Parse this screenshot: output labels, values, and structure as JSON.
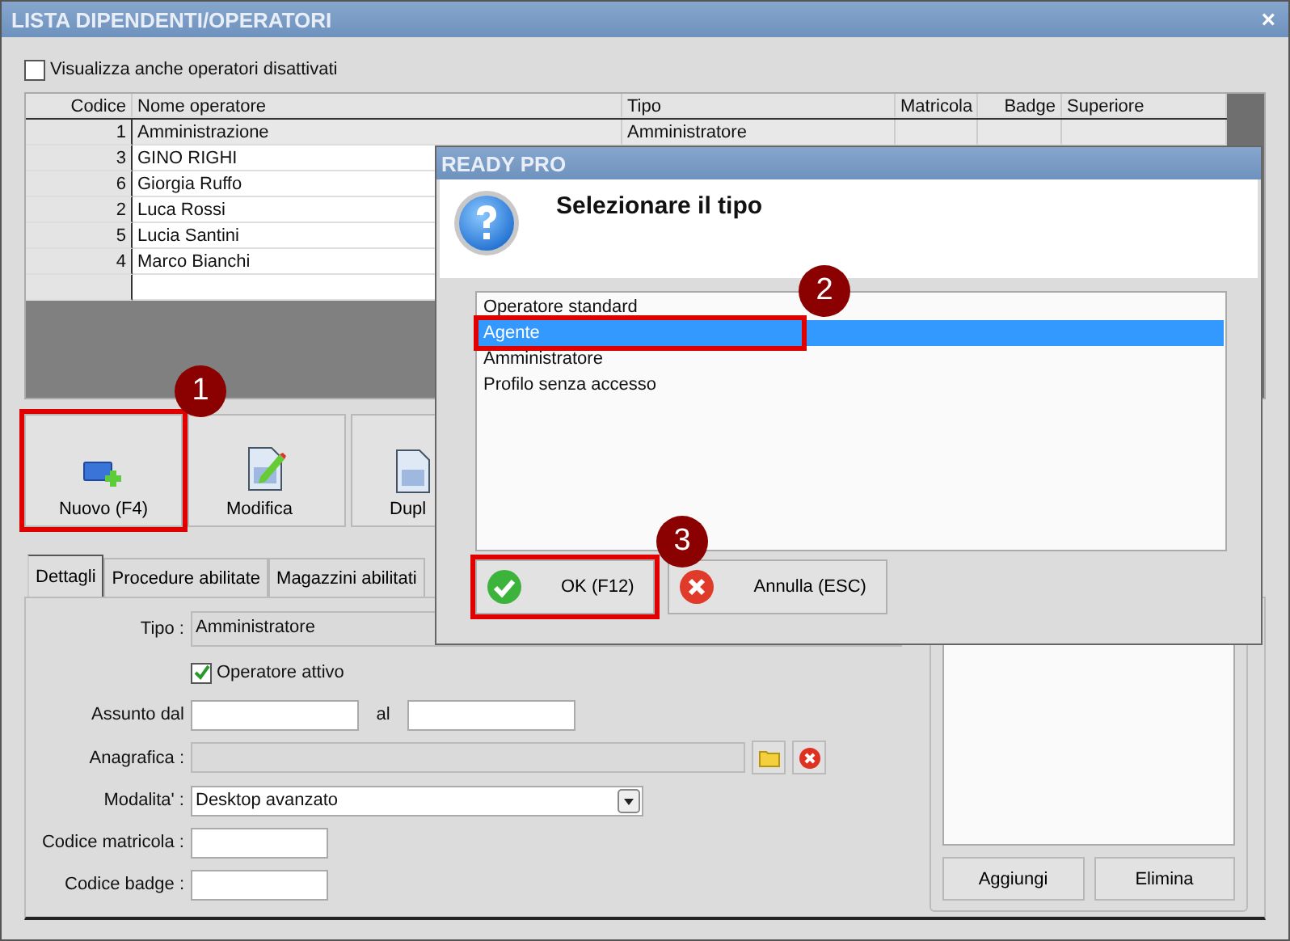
{
  "window": {
    "title": "LISTA DIPENDENTI/OPERATORI",
    "close": "×"
  },
  "show_disabled": {
    "label": "Visualizza anche operatori disattivati",
    "checked": false
  },
  "table": {
    "columns": [
      "Codice",
      "Nome operatore",
      "Tipo",
      "Matricola",
      "Badge",
      "Superiore"
    ],
    "rows": [
      {
        "code": "1",
        "name": "Amministrazione",
        "type": "Amministratore",
        "selected": true
      },
      {
        "code": "3",
        "name": "GINO RIGHI",
        "selected": false
      },
      {
        "code": "6",
        "name": "Giorgia Ruffo",
        "selected": false
      },
      {
        "code": "2",
        "name": "Luca Rossi",
        "selected": false
      },
      {
        "code": "5",
        "name": "Lucia Santini",
        "selected": false
      },
      {
        "code": "4",
        "name": "Marco Bianchi",
        "selected": false
      }
    ]
  },
  "toolbar": [
    {
      "label": "Nuovo (F4)",
      "kind": "new",
      "highlighted": true
    },
    {
      "label": "Modifica",
      "kind": "edit",
      "highlighted": false
    },
    {
      "label": "Dupl",
      "kind": "copy",
      "highlighted": false
    }
  ],
  "tabs": [
    {
      "label": "Dettagli",
      "selected": true
    },
    {
      "label": "Procedure abilitate",
      "selected": false
    },
    {
      "label": "Magazzini abilitati",
      "selected": false
    }
  ],
  "form": {
    "tipo": {
      "label": "Tipo :",
      "value": "Amministratore"
    },
    "active": {
      "label": "Operatore attivo",
      "checked": true
    },
    "hired": {
      "label": "Assunto dal",
      "to_label": "al"
    },
    "anagrafica": {
      "label": "Anagrafica :"
    },
    "mode": {
      "label": "Modalita' :",
      "value": "Desktop avanzato"
    },
    "matricola": {
      "label": "Codice matricola :"
    },
    "badge": {
      "label": "Codice badge :"
    }
  },
  "side_panel": {
    "buttons": [
      "Aggiungi",
      "Elimina"
    ]
  },
  "dialog": {
    "title": "READY PRO",
    "heading": "Selezionare il tipo",
    "options": [
      {
        "label": "Operatore standard",
        "selected": false,
        "highlighted": false
      },
      {
        "label": "Agente",
        "selected": true,
        "highlighted": true
      },
      {
        "label": "Amministratore",
        "selected": false,
        "highlighted": false
      },
      {
        "label": "Profilo senza accesso",
        "selected": false,
        "highlighted": false
      }
    ],
    "buttons": [
      {
        "label": "OK (F12)",
        "kind": "ok",
        "highlighted": true
      },
      {
        "label": "Annulla (ESC)",
        "kind": "cancel",
        "highlighted": false
      }
    ]
  },
  "annotations": [
    {
      "number": "1"
    },
    {
      "number": "2"
    },
    {
      "number": "3"
    }
  ]
}
